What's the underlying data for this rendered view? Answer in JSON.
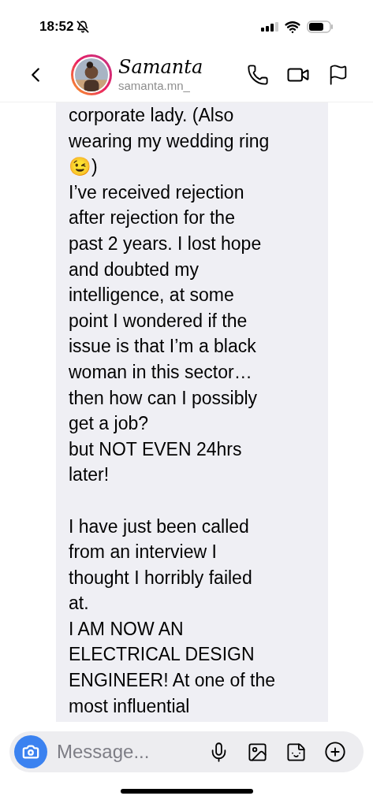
{
  "status_bar": {
    "time": "18:52"
  },
  "header": {
    "name": "Samanta",
    "username": "samanta.mn_"
  },
  "message": {
    "text": "corporate lady. (Also\nwearing my wedding ring\n😉)\nI’ve received rejection\nafter rejection for the\npast 2 years. I lost hope\nand doubted my\nintelligence, at some\npoint I wondered if the\nissue is that I’m a black\nwoman in this sector…\nthen how can I possibly\nget a job?\nbut NOT EVEN 24hrs\nlater!\n\nI have just been called\nfrom an interview I\nthought I horribly failed\nat.\nI AM NOW AN\nELECTRICAL DESIGN\nENGINEER! At one of the\nmost influential"
  },
  "composer": {
    "placeholder": "Message..."
  }
}
